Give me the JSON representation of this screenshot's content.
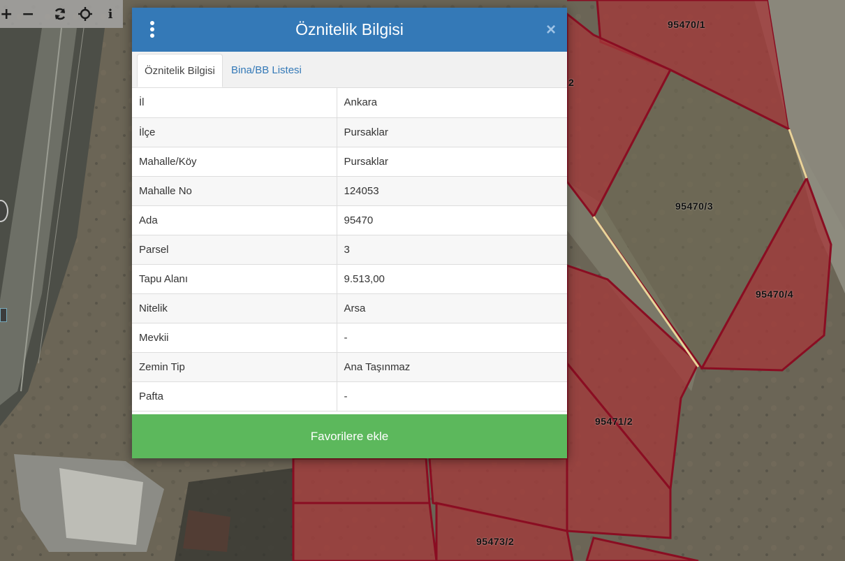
{
  "toolbar": {
    "buttons": [
      {
        "name": "zoom-in",
        "glyph": "+"
      },
      {
        "name": "zoom-out",
        "glyph": "−"
      },
      {
        "name": "refresh",
        "glyph": ""
      },
      {
        "name": "locate",
        "glyph": ""
      },
      {
        "name": "info",
        "glyph": "i"
      }
    ]
  },
  "map": {
    "parcel_labels": [
      "95470/1",
      "95470/3",
      "95470/4",
      "95471/2",
      "95473/2",
      "2"
    ],
    "parcel_fill_color": "#a33a3a",
    "parcel_border_color": "#8a0d22",
    "selected_border_color": "#e8d59a"
  },
  "dialog": {
    "title": "Öznitelik Bilgisi",
    "header_color": "#3479b7",
    "close_icon": "×",
    "tabs": [
      {
        "label": "Öznitelik Bilgisi",
        "active": true
      },
      {
        "label": "Bina/BB Listesi",
        "active": false
      }
    ],
    "rows": [
      {
        "key": "İl",
        "value": "Ankara"
      },
      {
        "key": "İlçe",
        "value": "Pursaklar"
      },
      {
        "key": "Mahalle/Köy",
        "value": "Pursaklar"
      },
      {
        "key": "Mahalle No",
        "value": "124053"
      },
      {
        "key": "Ada",
        "value": "95470"
      },
      {
        "key": "Parsel",
        "value": "3"
      },
      {
        "key": "Tapu Alanı",
        "value": "9.513,00"
      },
      {
        "key": "Nitelik",
        "value": "Arsa"
      },
      {
        "key": "Mevkii",
        "value": "-"
      },
      {
        "key": "Zemin Tip",
        "value": "Ana Taşınmaz"
      },
      {
        "key": "Pafta",
        "value": "-"
      }
    ],
    "favorite_button": "Favorilere ekle",
    "favorite_color": "#5cb85c"
  }
}
